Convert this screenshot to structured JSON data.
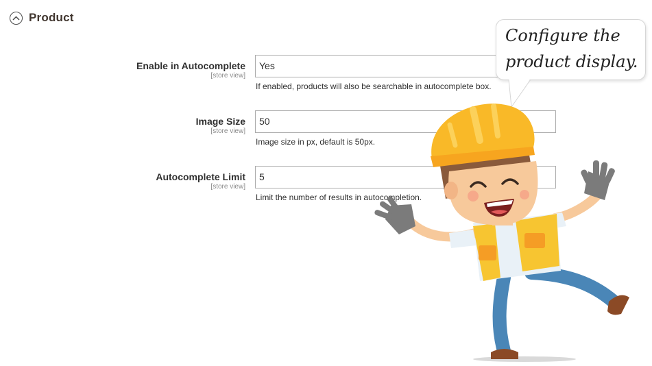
{
  "section": {
    "title": "Product",
    "icon": "chevron-up-circle-icon"
  },
  "fields": [
    {
      "label": "Enable in Autocomplete",
      "scope": "[store view]",
      "value": "Yes",
      "note": "If enabled, products will also be searchable in autocomplete box."
    },
    {
      "label": "Image Size",
      "scope": "[store view]",
      "value": "50",
      "note": "Image size in px, default is 50px."
    },
    {
      "label": "Autocomplete Limit",
      "scope": "[store view]",
      "value": "5",
      "note": "Limit the number of results in autocompletion."
    }
  ],
  "bubble": {
    "line1": "Configure the",
    "line2": "product display."
  },
  "colors": {
    "helmet": "#f9b928",
    "vest": "#f7c531",
    "pants": "#4a86b7",
    "glove": "#7b7b7b",
    "skin": "#f7c99b",
    "boot": "#8b4a26"
  }
}
